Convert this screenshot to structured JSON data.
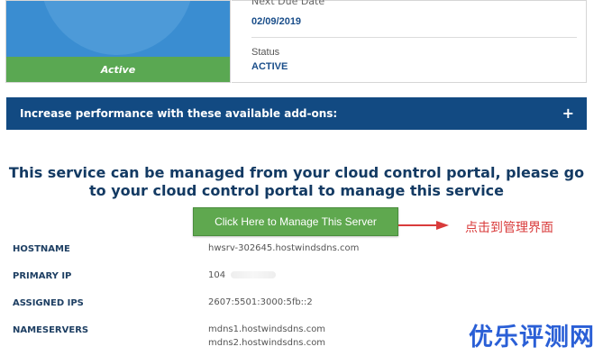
{
  "product": {
    "status_badge": "Active"
  },
  "info": {
    "cut_label": "Next Due Date",
    "due_date": "02/09/2019",
    "status_label": "Status",
    "status_value": "ACTIVE"
  },
  "addons": {
    "label": "Increase performance with these available add-ons:",
    "expand_icon": "+"
  },
  "headline": "This service can be managed from your cloud control portal, please go to your cloud control portal to manage this service",
  "manage_button": "Click Here to Manage This Server",
  "annotation": "点击到管理界面",
  "details": {
    "hostname_label": "HOSTNAME",
    "hostname_value": "hwsrv-302645.hostwindsdns.com",
    "primary_ip_label": "PRIMARY IP",
    "primary_ip_value": "104",
    "assigned_ips_label": "ASSIGNED IPS",
    "assigned_ips_value": "2607:5501:3000:5fb::2",
    "nameservers_label": "NAMESERVERS",
    "nameserver_1": "mdns1.hostwindsdns.com",
    "nameserver_2": "mdns2.hostwindsdns.com"
  },
  "watermark": "优乐评测网",
  "colors": {
    "addons_bar": "#124a82",
    "manage_button": "#5fa84f",
    "status_strip": "#5aa852",
    "heading": "#133a63",
    "annotation": "#d93b3b",
    "watermark": "#2a5fd6"
  }
}
